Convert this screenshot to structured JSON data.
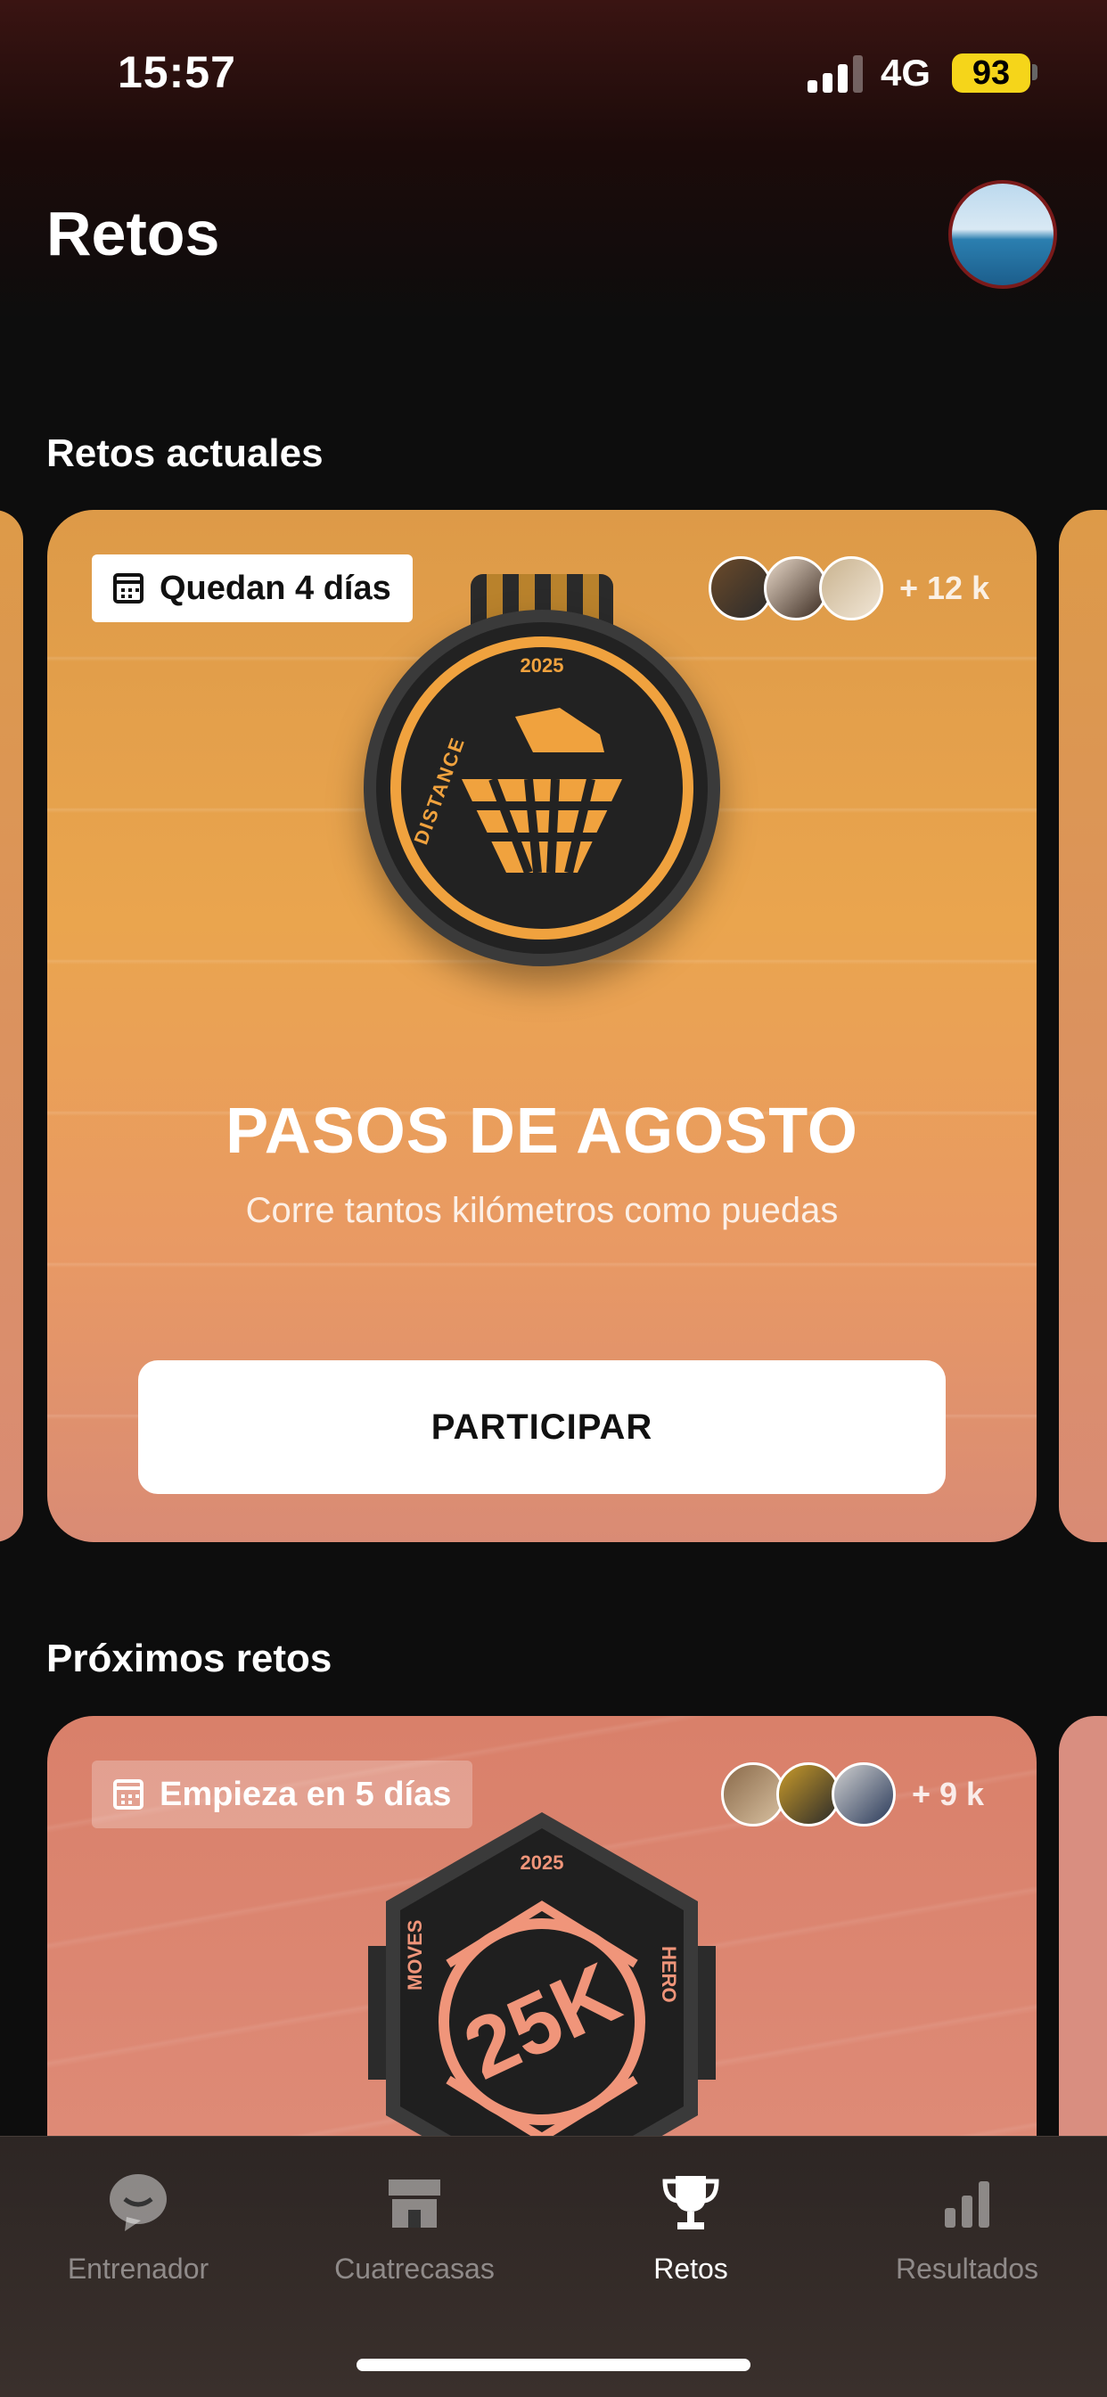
{
  "status_bar": {
    "time": "15:57",
    "network": "4G",
    "battery": "93"
  },
  "header": {
    "title": "Retos",
    "avatar_icon": "profile-avatar"
  },
  "sections": {
    "current_title": "Retos actuales",
    "upcoming_title": "Próximos retos"
  },
  "current_challenge": {
    "badge_text": "Quedan 4 días",
    "participants_count": "+ 12 k",
    "medal_year": "2025",
    "medal_side_text": "DISTANCE",
    "title": "PASOS DE AGOSTO",
    "subtitle": "Corre tantos kilómetros como puedas",
    "cta_label": "PARTICIPAR",
    "accent_color": "#f0a23e"
  },
  "upcoming_challenge": {
    "badge_text": "Empieza en 5 días",
    "participants_count": "+ 9 k",
    "medal_year": "2025",
    "medal_left_text": "MOVES",
    "medal_right_text": "HERO",
    "medal_center_text": "25K",
    "accent_color": "#f0957a"
  },
  "tabbar": {
    "items": [
      {
        "label": "Entrenador",
        "icon": "chat-bubble-icon",
        "active": false
      },
      {
        "label": "Cuatrecasas",
        "icon": "store-icon",
        "active": false
      },
      {
        "label": "Retos",
        "icon": "trophy-icon",
        "active": true
      },
      {
        "label": "Resultados",
        "icon": "bar-chart-icon",
        "active": false
      }
    ]
  }
}
